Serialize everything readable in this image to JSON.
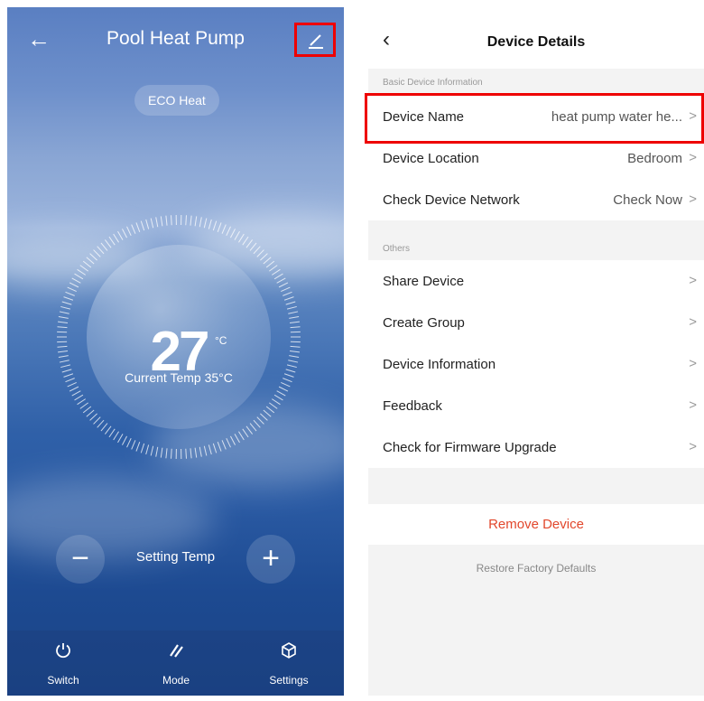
{
  "left": {
    "title": "Pool Heat Pump",
    "mode_badge": "ECO Heat",
    "setting_temp": "27",
    "unit": "°C",
    "current_temp": "Current Temp 35°C",
    "setting_label": "Setting Temp",
    "minus": "−",
    "plus": "+",
    "tabs": [
      {
        "label": "Switch",
        "icon": "power-icon"
      },
      {
        "label": "Mode",
        "icon": "mode-icon"
      },
      {
        "label": "Settings",
        "icon": "settings-icon"
      }
    ]
  },
  "right": {
    "title": "Device Details",
    "sections": [
      {
        "title": "Basic Device Information"
      },
      {
        "title": "Others"
      }
    ],
    "rows": [
      {
        "label": "Device Name",
        "value": "heat pump water he..."
      },
      {
        "label": "Device Location",
        "value": "Bedroom"
      },
      {
        "label": "Check Device Network",
        "value": "Check Now"
      },
      {
        "label": "Share Device",
        "value": ""
      },
      {
        "label": "Create Group",
        "value": ""
      },
      {
        "label": "Device Information",
        "value": ""
      },
      {
        "label": "Feedback",
        "value": ""
      },
      {
        "label": "Check for Firmware Upgrade",
        "value": ""
      }
    ],
    "remove": "Remove Device",
    "restore": "Restore Factory Defaults"
  },
  "colors": {
    "highlight": "#e00000",
    "remove": "#e2472c"
  }
}
